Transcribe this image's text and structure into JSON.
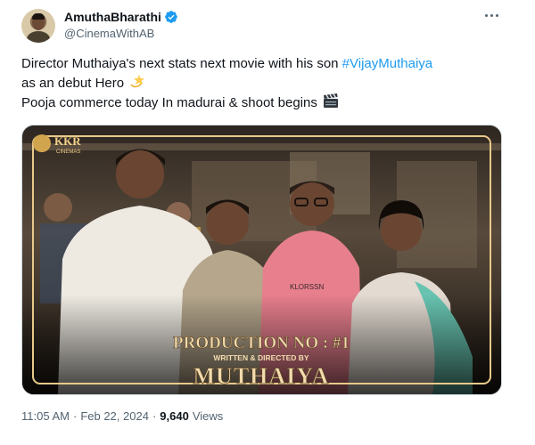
{
  "author": {
    "display_name": "AmuthaBharathi",
    "handle": "@CinemaWithAB",
    "verified": true
  },
  "post": {
    "line1": "Director Muthaiya's next stats next movie with his son ",
    "hashtag": "#VijayMuthaiya",
    "line2": "as an debut Hero",
    "line2_emoji": "dizzy-star-icon",
    "line3": "Pooja commerce today In madurai & shoot begins",
    "line3_emoji": "clapper-board-icon"
  },
  "media": {
    "logo_text": "KKR",
    "logo_sub": "CINEMAS",
    "shirt_text": "KLORSSN",
    "poster_title": "PRODUCTION  NO : #1",
    "poster_sub": "WRITTEN & DIRECTED BY",
    "poster_name": "MUTHAIYA"
  },
  "meta": {
    "time": "11:05 AM",
    "separator": "·",
    "date": "Feb 22, 2024",
    "views_count": "9,640",
    "views_label": "Views"
  },
  "colors": {
    "accent": "#1d9bf0",
    "text": "#0f1419",
    "muted": "#536471",
    "poster_gold": "#e8c98a"
  }
}
